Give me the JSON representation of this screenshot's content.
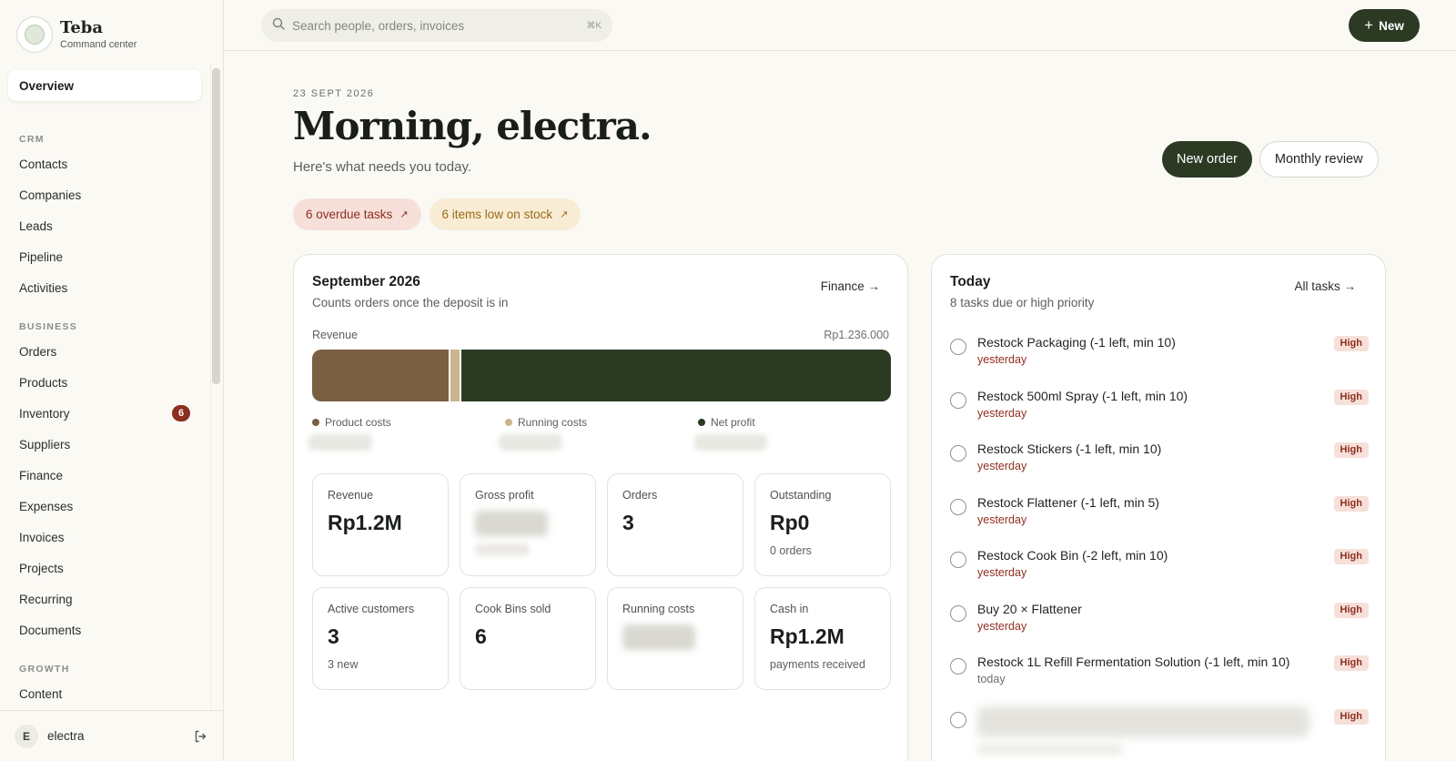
{
  "brand": {
    "name": "Teba",
    "subtitle": "Command center"
  },
  "sidebar": {
    "active": "Overview",
    "sections": [
      {
        "title": "",
        "items": [
          {
            "label": "Overview",
            "active": true
          }
        ]
      },
      {
        "title": "CRM",
        "items": [
          {
            "label": "Contacts"
          },
          {
            "label": "Companies"
          },
          {
            "label": "Leads"
          },
          {
            "label": "Pipeline"
          },
          {
            "label": "Activities"
          }
        ]
      },
      {
        "title": "BUSINESS",
        "items": [
          {
            "label": "Orders"
          },
          {
            "label": "Products"
          },
          {
            "label": "Inventory",
            "badge": "6"
          },
          {
            "label": "Suppliers"
          },
          {
            "label": "Finance"
          },
          {
            "label": "Expenses"
          },
          {
            "label": "Invoices"
          },
          {
            "label": "Projects"
          },
          {
            "label": "Recurring"
          },
          {
            "label": "Documents"
          }
        ]
      },
      {
        "title": "GROWTH",
        "items": [
          {
            "label": "Content"
          }
        ]
      }
    ],
    "user": {
      "initial": "E",
      "name": "electra"
    }
  },
  "topbar": {
    "search_placeholder": "Search people, orders, invoices",
    "shortcut": "⌘K",
    "new_label": "New"
  },
  "hero": {
    "date": "23 SEPT 2026",
    "greeting": "Morning, electra.",
    "subtitle": "Here's what needs you today.",
    "new_order_label": "New order",
    "monthly_review_label": "Monthly review",
    "overdue_pill": "6 overdue tasks",
    "stock_pill": "6 items low on stock"
  },
  "finance_card": {
    "title": "September 2026",
    "subtitle": "Counts orders once the deposit is in",
    "link": "Finance →",
    "revenue_label": "Revenue",
    "revenue_total": "Rp1.236.000",
    "revenue_breakdown": [
      {
        "name": "Product costs",
        "fraction": 0.236,
        "color": "#7a5f42"
      },
      {
        "name": "Running costs",
        "fraction": 0.018,
        "color": "#c9b68f"
      },
      {
        "name": "Net profit",
        "fraction": 0.746,
        "color": "#2c3a24"
      }
    ],
    "stats": [
      {
        "label": "Revenue",
        "value": "Rp1.2M",
        "note": ""
      },
      {
        "label": "Gross profit",
        "value": "",
        "note": "",
        "hidden": true
      },
      {
        "label": "Orders",
        "value": "3",
        "note": ""
      },
      {
        "label": "Outstanding",
        "value": "Rp0",
        "note": "0 orders"
      },
      {
        "label": "Active customers",
        "value": "3",
        "note": "3 new"
      },
      {
        "label": "Cook Bins sold",
        "value": "6",
        "note": ""
      },
      {
        "label": "Running costs",
        "value": "",
        "note": "",
        "hidden": true
      },
      {
        "label": "Cash in",
        "value": "Rp1.2M",
        "note": "payments received"
      }
    ]
  },
  "today_card": {
    "title": "Today",
    "subtitle": "8 tasks due or high priority",
    "link": "All tasks →",
    "tasks": [
      {
        "title": "Restock Packaging (-1 left, min 10)",
        "due": "yesterday",
        "priority": "High"
      },
      {
        "title": "Restock 500ml Spray (-1 left, min 10)",
        "due": "yesterday",
        "priority": "High"
      },
      {
        "title": "Restock Stickers (-1 left, min 10)",
        "due": "yesterday",
        "priority": "High"
      },
      {
        "title": "Restock Flattener (-1 left, min 5)",
        "due": "yesterday",
        "priority": "High"
      },
      {
        "title": "Restock Cook Bin (-2 left, min 10)",
        "due": "yesterday",
        "priority": "High"
      },
      {
        "title": "Buy 20 × Flattener",
        "due": "yesterday",
        "priority": "High"
      },
      {
        "title": "Restock 1L Refill Fermentation Solution (-1 left, min 10)",
        "due": "today",
        "priority": "High"
      },
      {
        "title": "",
        "due": "",
        "priority": "High",
        "hidden": true
      }
    ]
  }
}
